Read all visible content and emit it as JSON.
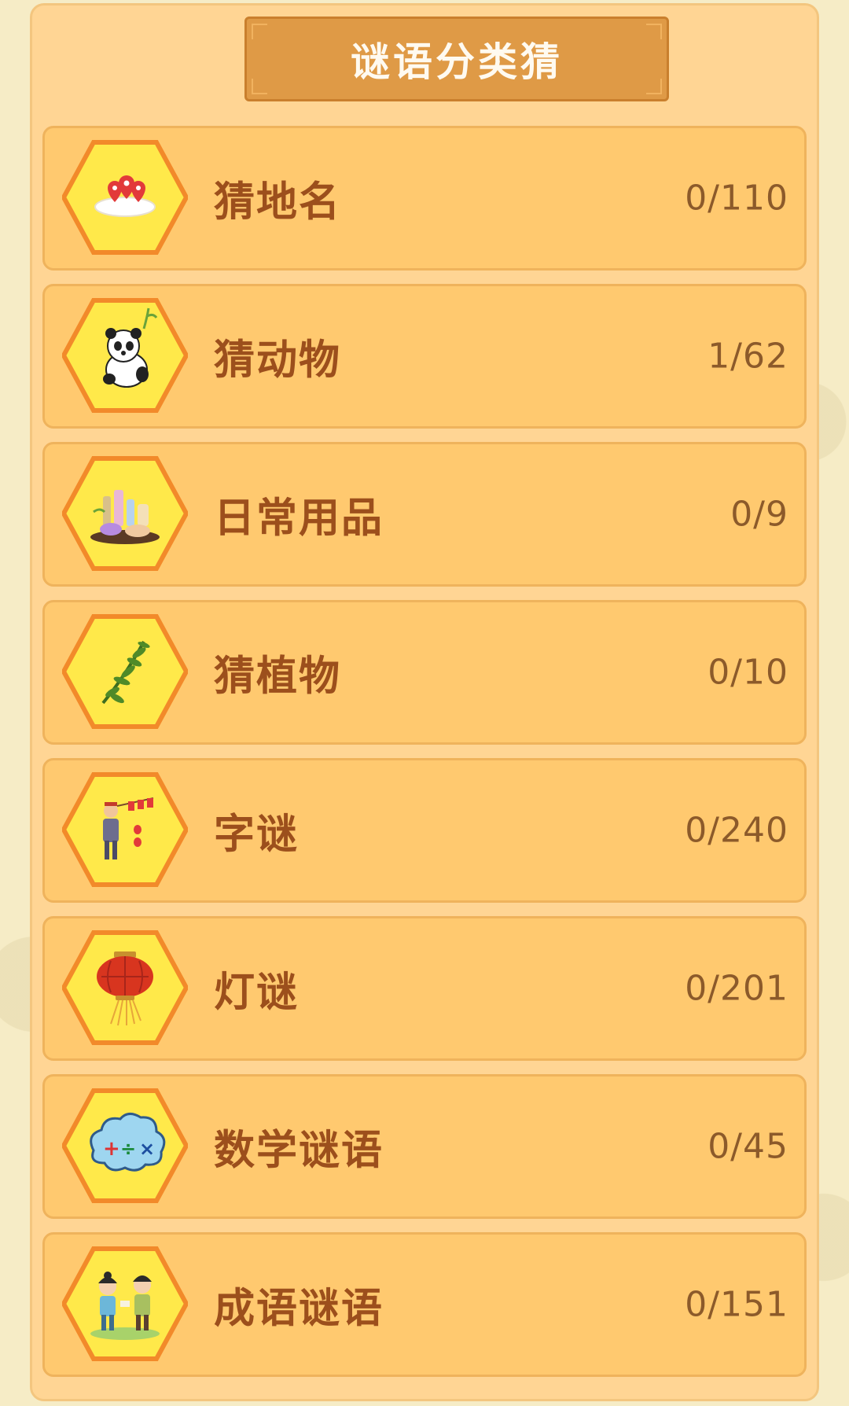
{
  "header": {
    "title": "谜语分类猜"
  },
  "categories": [
    {
      "label": "猜地名",
      "progress": "0/110",
      "icon": "map-pin-icon"
    },
    {
      "label": "猜动物",
      "progress": "1/62",
      "icon": "panda-icon"
    },
    {
      "label": "日常用品",
      "progress": "0/9",
      "icon": "daily-goods-icon"
    },
    {
      "label": "猜植物",
      "progress": "0/10",
      "icon": "plant-icon"
    },
    {
      "label": "字谜",
      "progress": "0/240",
      "icon": "character-riddle-icon"
    },
    {
      "label": "灯谜",
      "progress": "0/201",
      "icon": "lantern-icon"
    },
    {
      "label": "数学谜语",
      "progress": "0/45",
      "icon": "math-cloud-icon"
    },
    {
      "label": "成语谜语",
      "progress": "0/151",
      "icon": "kids-idiom-icon"
    }
  ],
  "colors": {
    "panel": "#ffd594",
    "row": "#ffc96f",
    "title_bar": "#df9a46",
    "label_text": "#9c4f1c",
    "hex_fill": "#ffe94a",
    "hex_border": "#f28a2a"
  }
}
